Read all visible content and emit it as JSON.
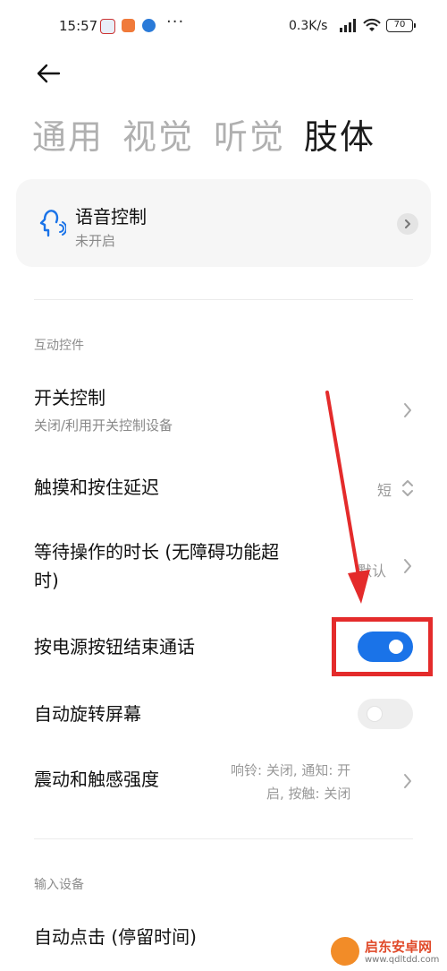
{
  "status_bar": {
    "time": "15:57",
    "dots": "···",
    "speed": "0.3K/s",
    "battery": "70"
  },
  "tabs": [
    {
      "label": "通用"
    },
    {
      "label": "视觉"
    },
    {
      "label": "听觉"
    },
    {
      "label": "肢体",
      "active": true
    }
  ],
  "voice_control": {
    "title": "语音控制",
    "subtitle": "未开启"
  },
  "sections": {
    "interactive": "互动控件",
    "input": "输入设备"
  },
  "rows": {
    "switch_control": {
      "title": "开关控制",
      "subtitle": "关闭/利用开关控制设备"
    },
    "touch_delay": {
      "title": "触摸和按住延迟",
      "value": "短"
    },
    "wait_time": {
      "title_line1": "等待操作的时长 (无障碍功能超",
      "title_line2": "时)",
      "value": "默认"
    },
    "power_end_call": {
      "title": "按电源按钮结束通话",
      "toggle_on": true
    },
    "auto_rotate": {
      "title": "自动旋转屏幕",
      "toggle_on": false
    },
    "vibration": {
      "title": "震动和触感强度",
      "value_line1": "响铃: 关闭, 通知: 开",
      "value_line2": "启, 按触: 关闭"
    },
    "auto_click": {
      "title": "自动点击 (停留时间)"
    }
  },
  "watermark": {
    "name": "启东安卓网",
    "url": "www.qdltdd.com"
  },
  "colors": {
    "accent": "#1a73e8",
    "annotation": "#e42b2b"
  }
}
